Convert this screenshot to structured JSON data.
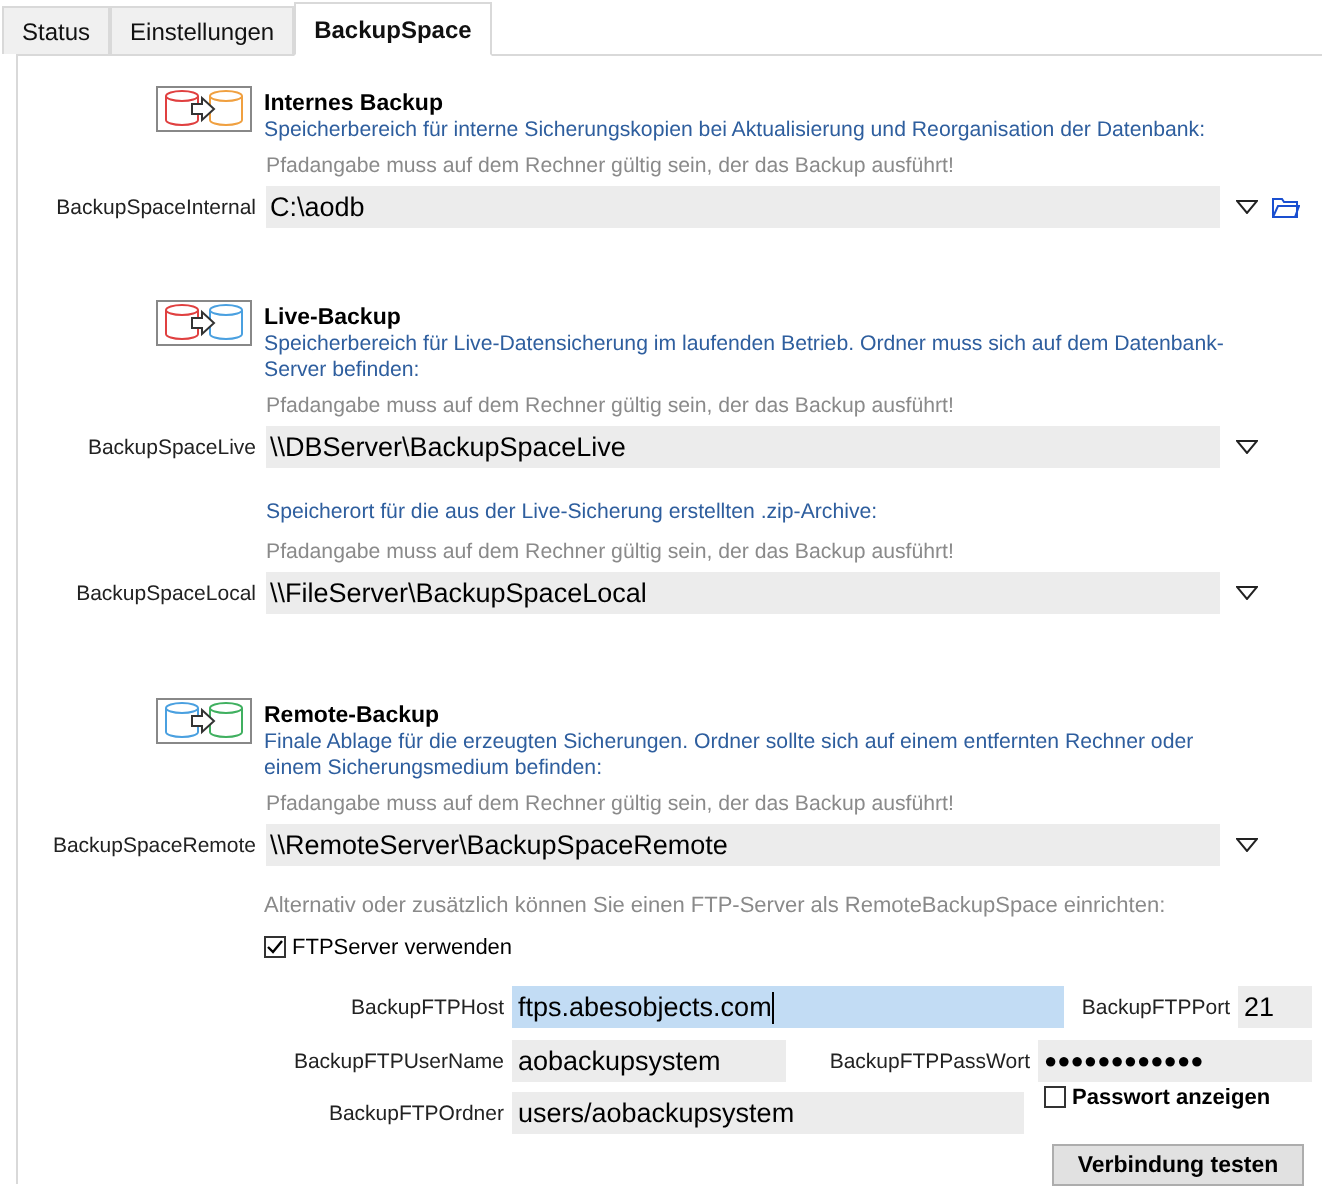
{
  "tabs": [
    {
      "label": "Status",
      "selected": false
    },
    {
      "label": "Einstellungen",
      "selected": false
    },
    {
      "label": "BackupSpace",
      "selected": true
    }
  ],
  "sections": [
    {
      "kind": "internal",
      "title": "Internes Backup",
      "description": "Speicherbereich für interne Sicherungskopien bei Aktualisierung und Reorganisation der Datenbank:",
      "paths": [
        {
          "hint": "Pfadangabe muss auf dem Rechner gültig sein, der das Backup ausführt!",
          "label": "BackupSpaceInternal",
          "value": "C:\\aodb",
          "folder_button": true
        }
      ]
    },
    {
      "kind": "live",
      "title": "Live-Backup",
      "description": "Speicherbereich für Live-Datensicherung im laufenden Betrieb. Ordner muss sich auf dem Datenbank-Server befinden:",
      "paths": [
        {
          "hint": "Pfadangabe muss auf dem Rechner gültig sein, der das Backup ausführt!",
          "label": "BackupSpaceLive",
          "value": "\\\\DBServer\\BackupSpaceLive",
          "folder_button": false
        },
        {
          "intro": "Speicherort für die aus der Live-Sicherung erstellten .zip-Archive:",
          "hint": "Pfadangabe muss auf dem Rechner gültig sein, der das Backup ausführt!",
          "label": "BackupSpaceLocal",
          "value": "\\\\FileServer\\BackupSpaceLocal",
          "folder_button": false
        }
      ]
    },
    {
      "kind": "remote",
      "title": "Remote-Backup",
      "description": "Finale Ablage für die erzeugten Sicherungen. Ordner sollte sich auf einem entfernten Rechner oder einem Sicherungsmedium befinden:",
      "paths": [
        {
          "hint": "Pfadangabe muss auf dem Rechner gültig sein, der das Backup ausführt!",
          "label": "BackupSpaceRemote",
          "value": "\\\\RemoteServer\\BackupSpaceRemote",
          "folder_button": false
        }
      ]
    }
  ],
  "ftp": {
    "note": "Alternativ oder zusätzlich können Sie einen FTP-Server als RemoteBackupSpace einrichten:",
    "use_ftp": {
      "label": "FTPServer verwenden",
      "checked": true
    },
    "host": {
      "label": "BackupFTPHost",
      "value": "ftps.abesobjects.com",
      "text_selected": true
    },
    "port": {
      "label": "BackupFTPPort",
      "value": "21"
    },
    "username": {
      "label": "BackupFTPUserName",
      "value": "aobackupsystem"
    },
    "password": {
      "label": "BackupFTPPassWort",
      "value": "●●●●●●●●●●●●"
    },
    "show_password": {
      "label": "Passwort anzeigen",
      "checked": false
    },
    "folder": {
      "label": "BackupFTPOrdner",
      "value": "users/aobackupsystem"
    },
    "test_button": "Verbindung testen"
  }
}
